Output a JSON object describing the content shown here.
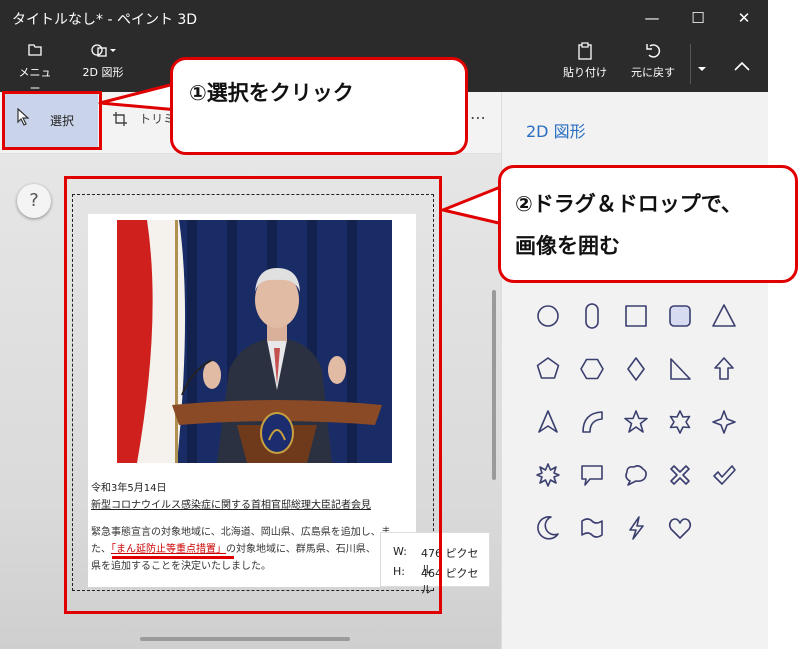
{
  "window": {
    "title": "タイトルなし* - ペイント 3D",
    "minimize": "—",
    "maximize": "☐",
    "close": "✕"
  },
  "ribbon": {
    "menu_label": "メニュー",
    "shapes2d_label": "2D 図形",
    "paste_label": "貼り付け",
    "undo_label": "元に戻す",
    "more_icon": "chevron-down-icon",
    "collapse_icon": "chevron-up-icon"
  },
  "toolbar": {
    "select_label": "選択",
    "crop_label": "トリミ",
    "more_label": "⋯"
  },
  "canvas": {
    "help_label": "?",
    "article_date": "令和3年5月14日",
    "article_headline": "新型コロナウイルス感染症に関する首相官邸総理大臣記者会見",
    "article_body_1": "緊急事態宣言の対象地域に、北海道、岡山県、広島県を追加し、ま",
    "article_body_2a": "た、",
    "article_body_2b": "「まん延防止等重点措置」",
    "article_body_2c": "の対象地域に、群馬県、石川県、",
    "article_body_3": "県を追加することを決定いたしました。"
  },
  "size_tooltip": {
    "w_label": "W:",
    "w_value": "476 ピクセル",
    "h_label": "H:",
    "h_value": "464 ピクセル"
  },
  "panel": {
    "title": "2D 図形",
    "shapes": [
      "circle",
      "pill",
      "square",
      "rounded-square",
      "triangle",
      "pentagon",
      "hexagon",
      "diamond",
      "right-triangle",
      "arrow-up",
      "arrowhead",
      "quarter-arc",
      "star-5",
      "star-6",
      "star-4",
      "burst",
      "speech-bubble-rect",
      "speech-bubble-cloud",
      "x-mark",
      "check-mark",
      "crescent",
      "wave-banner",
      "lightning",
      "heart"
    ]
  },
  "annotations": {
    "callout1": "①選択をクリック",
    "callout2_line1": "②ドラグ＆ドロップで、",
    "callout2_line2": "画像を囲む"
  },
  "colors": {
    "titlebar": "#2b2b2b",
    "accent_blue": "#2a6fc1",
    "annotation_red": "#e00000",
    "select_highlight": "#c9d3ea"
  }
}
